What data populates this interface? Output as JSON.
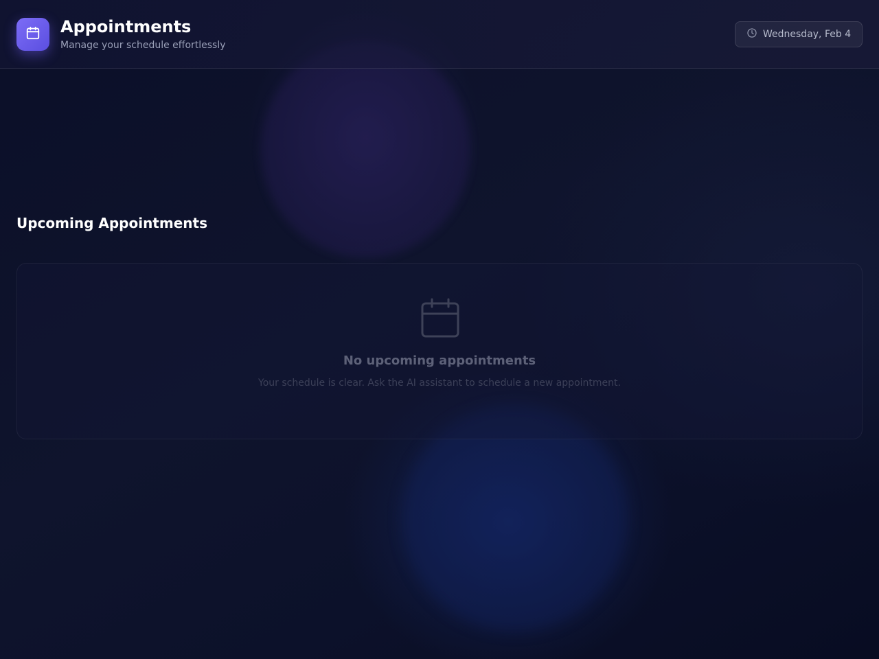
{
  "header": {
    "title": "Appointments",
    "subtitle": "Manage your schedule effortlessly",
    "logo_icon": "calendar-icon",
    "date_icon": "clock-icon",
    "date": "Wednesday, Feb 4"
  },
  "upcoming": {
    "heading": "Upcoming Appointments",
    "empty_state": {
      "icon": "calendar-icon",
      "title": "No upcoming appointments",
      "description": "Your schedule is clear. Ask the AI assistant to schedule a new appointment."
    }
  },
  "colors": {
    "accent": "#6c5ce7",
    "background": "#0d1129",
    "muted_text": "#9aa0b8"
  }
}
